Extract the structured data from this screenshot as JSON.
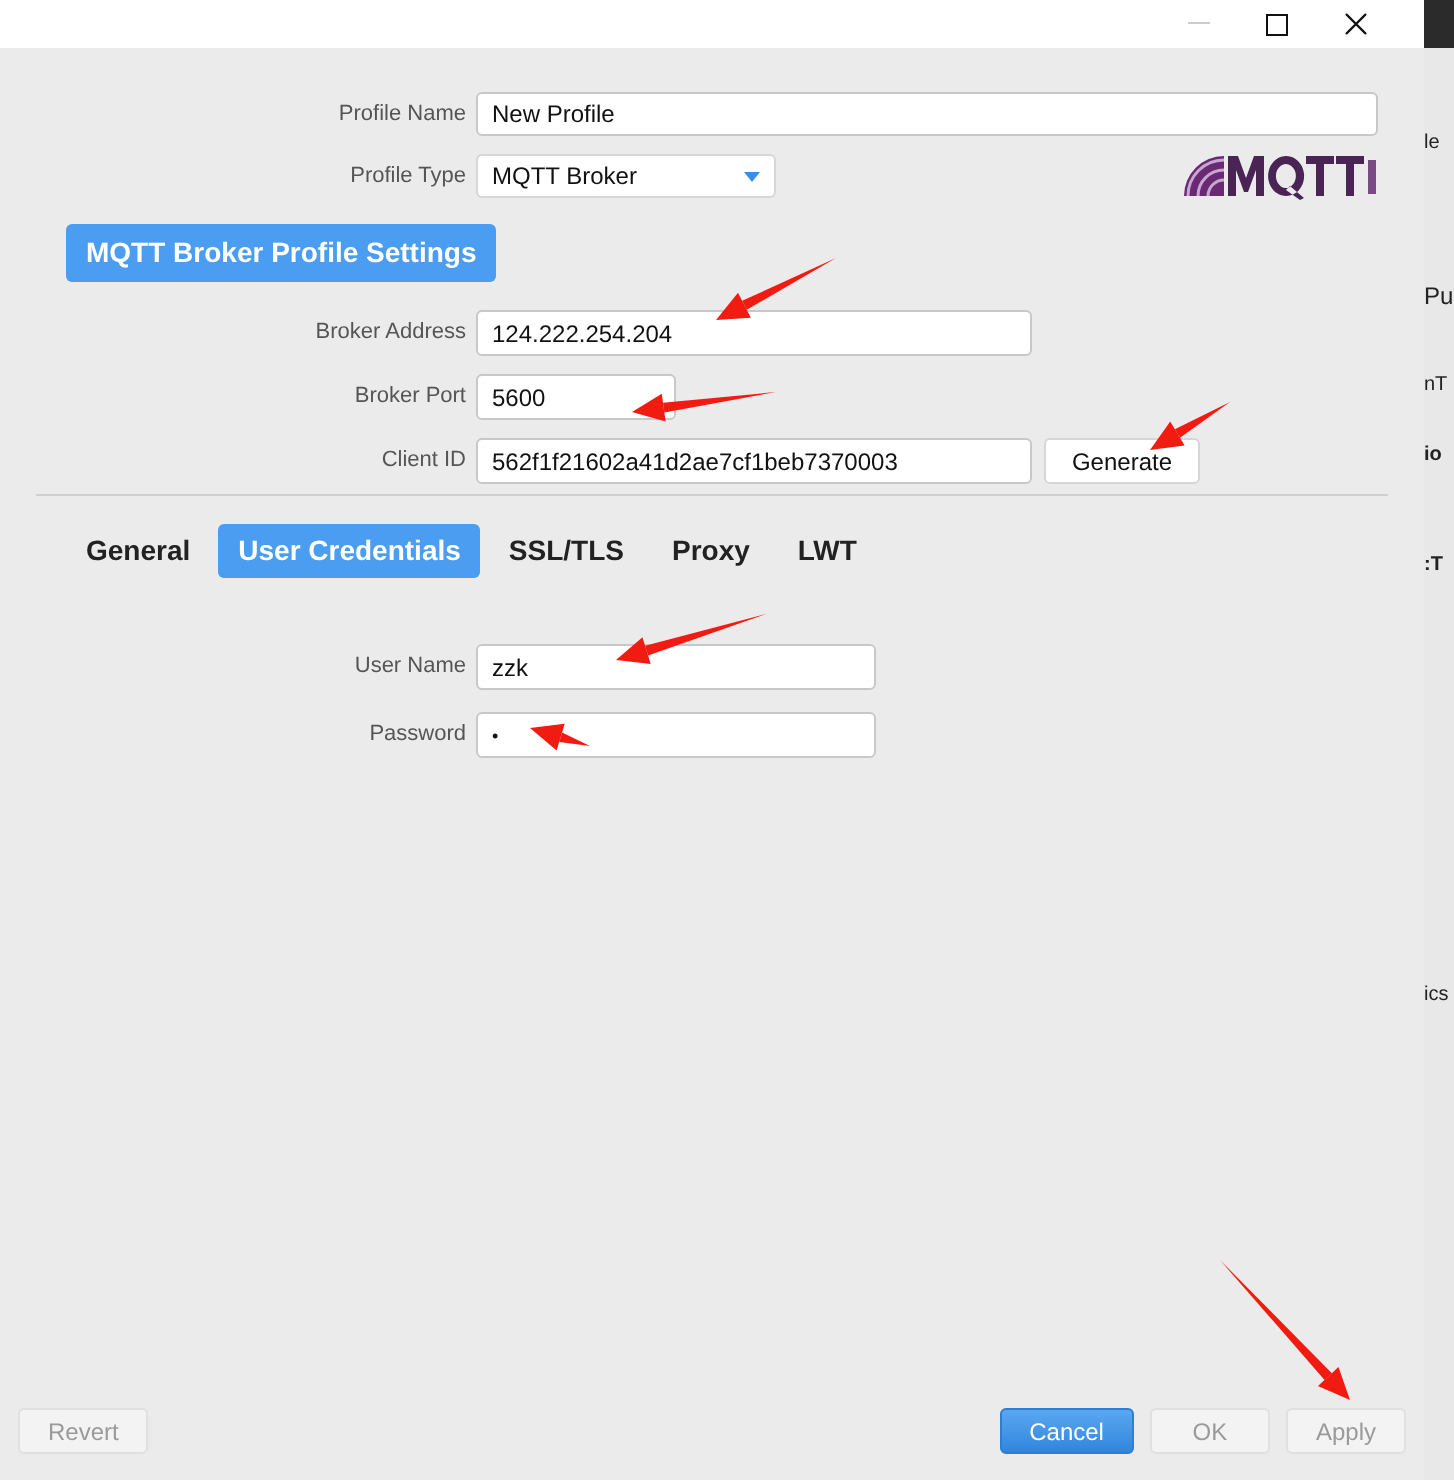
{
  "form": {
    "fields": [
      {
        "label": "Profile Name",
        "kind": "text",
        "value": "New Profile"
      },
      {
        "label": "Profile Type",
        "kind": "select",
        "value": "MQTT Broker"
      }
    ]
  },
  "section_title": "MQTT Broker Profile Settings",
  "broker": [
    {
      "label": "Broker Address",
      "value": "124.222.254.204",
      "kind": "text"
    },
    {
      "label": "Broker Port",
      "value": "5600",
      "kind": "port"
    },
    {
      "label": "Client ID",
      "value": "562f1f21602a41d2ae7cf1beb7370003",
      "kind": "text"
    }
  ],
  "generate_button": "Generate",
  "tabs": [
    {
      "label": "General",
      "selected": false
    },
    {
      "label": "User Credentials",
      "selected": true
    },
    {
      "label": "SSL/TLS",
      "selected": false
    },
    {
      "label": "Proxy",
      "selected": false
    },
    {
      "label": "LWT",
      "selected": false
    }
  ],
  "credentials": [
    {
      "label": "User Name",
      "value": "zzk",
      "kind": "text"
    },
    {
      "label": "Password",
      "value": "•",
      "kind": "password"
    }
  ],
  "buttons": [
    {
      "label": "Revert",
      "kind": "plain",
      "disabled": true
    },
    {
      "label": "Cancel",
      "kind": "primary",
      "disabled": false
    },
    {
      "label": "OK",
      "kind": "plain",
      "disabled": true
    },
    {
      "label": "Apply",
      "kind": "plain",
      "disabled": true
    }
  ],
  "background_window": [
    "le",
    "Pu",
    "nT",
    "io",
    ":T",
    "ics"
  ]
}
